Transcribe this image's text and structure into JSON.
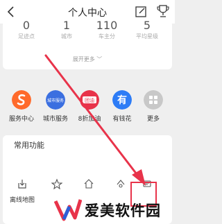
{
  "header": {
    "title": "个人中心"
  },
  "stats": [
    {
      "value": "0",
      "label": "足迹点"
    },
    {
      "value": "1",
      "label": "城市"
    },
    {
      "value": "110",
      "label": "车主分"
    },
    {
      "value": "5",
      "label": "平均星级"
    }
  ],
  "expand_more": "展开更多 ﹀",
  "services": [
    {
      "label": "服务中心",
      "icon": "s-logo-icon",
      "color": "#ff6a2b"
    },
    {
      "label": "城市服务",
      "icon": "city-service-icon",
      "color": "#3b6fe0",
      "badge": "城市服务"
    },
    {
      "label": "8折加油",
      "icon": "fuel-discount-icon",
      "color": "#e8334a",
      "badge": "团油"
    },
    {
      "label": "有钱花",
      "icon": "youqianhua-icon",
      "color": "#2d7cf6",
      "badge": "有"
    },
    {
      "label": "更多",
      "icon": "more-grid-icon",
      "color": "#c8c8c8"
    }
  ],
  "common": {
    "title": "常用功能",
    "items": [
      {
        "label": "离线地图",
        "icon": "offline-map-icon"
      },
      {
        "label": "",
        "icon": "star-icon"
      },
      {
        "label": "",
        "icon": "home-icon"
      },
      {
        "label": "",
        "icon": "location-icon"
      },
      {
        "label": "",
        "icon": "highlighted-function-icon"
      }
    ]
  },
  "watermark": {
    "text": "爱美软件园"
  },
  "colors": {
    "accent_red": "#e8334a"
  }
}
